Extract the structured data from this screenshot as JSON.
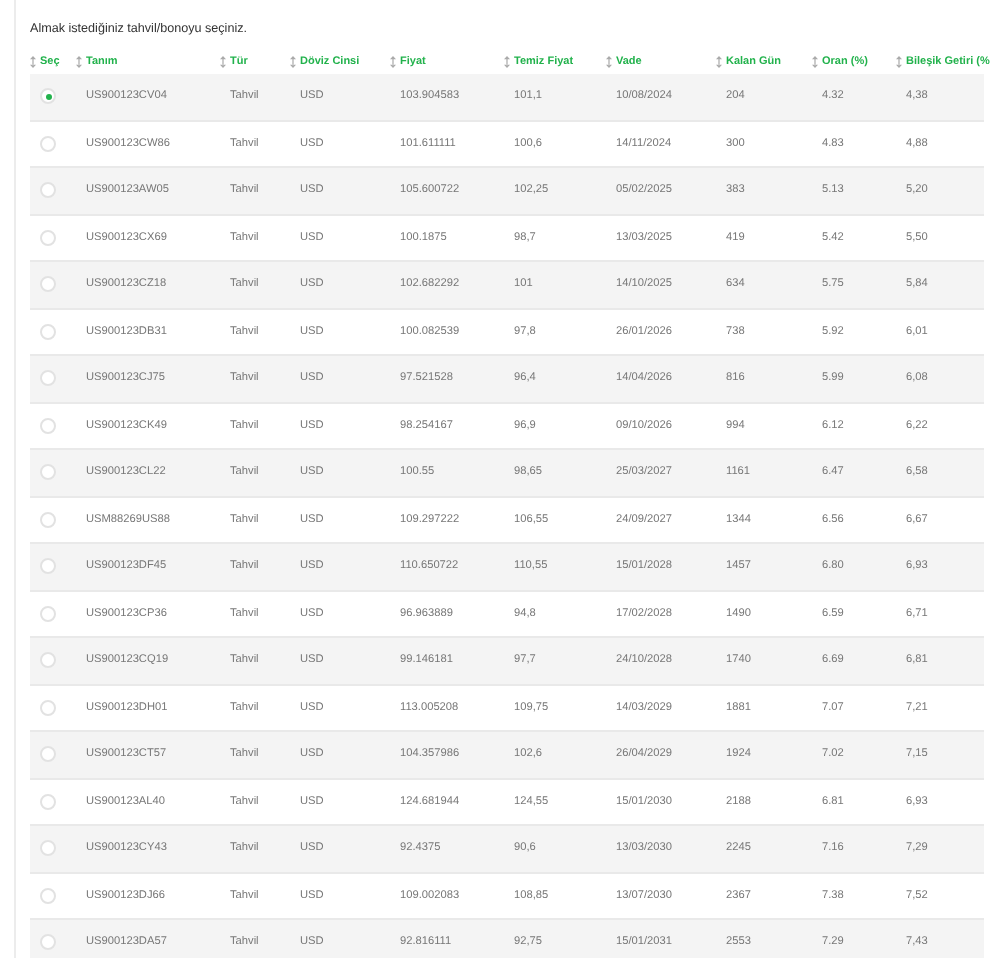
{
  "instruction": "Almak istediğiniz tahvil/bonoyu seçiniz.",
  "table": {
    "select_header": "Seç",
    "columns": [
      "Tanım",
      "Tür",
      "Döviz Cinsi",
      "Fiyat",
      "Temiz Fiyat",
      "Vade",
      "Kalan Gün",
      "Oran (%)",
      "Bileşik Getiri (%"
    ],
    "rows": [
      {
        "selected": true,
        "cells": [
          "US900123CV04",
          "Tahvil",
          "USD",
          "103.904583",
          "101,1",
          "10/08/2024",
          "204",
          "4.32",
          "4,38"
        ]
      },
      {
        "selected": false,
        "cells": [
          "US900123CW86",
          "Tahvil",
          "USD",
          "101.611111",
          "100,6",
          "14/11/2024",
          "300",
          "4.83",
          "4,88"
        ]
      },
      {
        "selected": false,
        "cells": [
          "US900123AW05",
          "Tahvil",
          "USD",
          "105.600722",
          "102,25",
          "05/02/2025",
          "383",
          "5.13",
          "5,20"
        ]
      },
      {
        "selected": false,
        "cells": [
          "US900123CX69",
          "Tahvil",
          "USD",
          "100.1875",
          "98,7",
          "13/03/2025",
          "419",
          "5.42",
          "5,50"
        ]
      },
      {
        "selected": false,
        "cells": [
          "US900123CZ18",
          "Tahvil",
          "USD",
          "102.682292",
          "101",
          "14/10/2025",
          "634",
          "5.75",
          "5,84"
        ]
      },
      {
        "selected": false,
        "cells": [
          "US900123DB31",
          "Tahvil",
          "USD",
          "100.082539",
          "97,8",
          "26/01/2026",
          "738",
          "5.92",
          "6,01"
        ]
      },
      {
        "selected": false,
        "cells": [
          "US900123CJ75",
          "Tahvil",
          "USD",
          "97.521528",
          "96,4",
          "14/04/2026",
          "816",
          "5.99",
          "6,08"
        ]
      },
      {
        "selected": false,
        "cells": [
          "US900123CK49",
          "Tahvil",
          "USD",
          "98.254167",
          "96,9",
          "09/10/2026",
          "994",
          "6.12",
          "6,22"
        ]
      },
      {
        "selected": false,
        "cells": [
          "US900123CL22",
          "Tahvil",
          "USD",
          "100.55",
          "98,65",
          "25/03/2027",
          "1161",
          "6.47",
          "6,58"
        ]
      },
      {
        "selected": false,
        "cells": [
          "USM88269US88",
          "Tahvil",
          "USD",
          "109.297222",
          "106,55",
          "24/09/2027",
          "1344",
          "6.56",
          "6,67"
        ]
      },
      {
        "selected": false,
        "cells": [
          "US900123DF45",
          "Tahvil",
          "USD",
          "110.650722",
          "110,55",
          "15/01/2028",
          "1457",
          "6.80",
          "6,93"
        ]
      },
      {
        "selected": false,
        "cells": [
          "US900123CP36",
          "Tahvil",
          "USD",
          "96.963889",
          "94,8",
          "17/02/2028",
          "1490",
          "6.59",
          "6,71"
        ]
      },
      {
        "selected": false,
        "cells": [
          "US900123CQ19",
          "Tahvil",
          "USD",
          "99.146181",
          "97,7",
          "24/10/2028",
          "1740",
          "6.69",
          "6,81"
        ]
      },
      {
        "selected": false,
        "cells": [
          "US900123DH01",
          "Tahvil",
          "USD",
          "113.005208",
          "109,75",
          "14/03/2029",
          "1881",
          "7.07",
          "7,21"
        ]
      },
      {
        "selected": false,
        "cells": [
          "US900123CT57",
          "Tahvil",
          "USD",
          "104.357986",
          "102,6",
          "26/04/2029",
          "1924",
          "7.02",
          "7,15"
        ]
      },
      {
        "selected": false,
        "cells": [
          "US900123AL40",
          "Tahvil",
          "USD",
          "124.681944",
          "124,55",
          "15/01/2030",
          "2188",
          "6.81",
          "6,93"
        ]
      },
      {
        "selected": false,
        "cells": [
          "US900123CY43",
          "Tahvil",
          "USD",
          "92.4375",
          "90,6",
          "13/03/2030",
          "2245",
          "7.16",
          "7,29"
        ]
      },
      {
        "selected": false,
        "cells": [
          "US900123DJ66",
          "Tahvil",
          "USD",
          "109.002083",
          "108,85",
          "13/07/2030",
          "2367",
          "7.38",
          "7,52"
        ]
      },
      {
        "selected": false,
        "cells": [
          "US900123DA57",
          "Tahvil",
          "USD",
          "92.816111",
          "92,75",
          "15/01/2031",
          "2553",
          "7.29",
          "7,43"
        ]
      }
    ]
  }
}
